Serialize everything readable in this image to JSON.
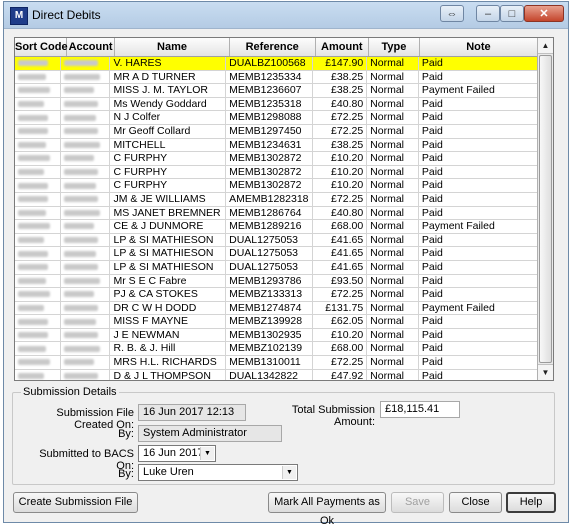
{
  "window": {
    "title": "Direct Debits",
    "app_icon": "lm-app-icon"
  },
  "columns": [
    "Sort Code",
    "Account",
    "Name",
    "Reference",
    "Amount",
    "Type",
    "Note"
  ],
  "rows": [
    {
      "name": "V. HARES",
      "ref": "DUALBZ100568",
      "amount": "£147.90",
      "type": "Normal",
      "note": "Paid",
      "selected": true
    },
    {
      "name": "MR A D TURNER",
      "ref": "MEMB1235334",
      "amount": "£38.25",
      "type": "Normal",
      "note": "Paid"
    },
    {
      "name": "MISS J. M. TAYLOR",
      "ref": "MEMB1236607",
      "amount": "£38.25",
      "type": "Normal",
      "note": "Payment Failed"
    },
    {
      "name": "Ms Wendy Goddard",
      "ref": "MEMB1235318",
      "amount": "£40.80",
      "type": "Normal",
      "note": "Paid"
    },
    {
      "name": "N J Colfer",
      "ref": "MEMB1298088",
      "amount": "£72.25",
      "type": "Normal",
      "note": "Paid"
    },
    {
      "name": "Mr Geoff Collard",
      "ref": "MEMB1297450",
      "amount": "£72.25",
      "type": "Normal",
      "note": "Paid"
    },
    {
      "name": "MITCHELL",
      "ref": "MEMB1234631",
      "amount": "£38.25",
      "type": "Normal",
      "note": "Paid"
    },
    {
      "name": "C FURPHY",
      "ref": "MEMB1302872",
      "amount": "£10.20",
      "type": "Normal",
      "note": "Paid"
    },
    {
      "name": "C FURPHY",
      "ref": "MEMB1302872",
      "amount": "£10.20",
      "type": "Normal",
      "note": "Paid"
    },
    {
      "name": "C FURPHY",
      "ref": "MEMB1302872",
      "amount": "£10.20",
      "type": "Normal",
      "note": "Paid"
    },
    {
      "name": "JM & JE WILLIAMS",
      "ref": "AMEMB1282318",
      "amount": "£72.25",
      "type": "Normal",
      "note": "Paid"
    },
    {
      "name": "MS JANET BREMNER",
      "ref": "MEMB1286764",
      "amount": "£40.80",
      "type": "Normal",
      "note": "Paid"
    },
    {
      "name": "CE & J DUNMORE",
      "ref": "MEMB1289216",
      "amount": "£68.00",
      "type": "Normal",
      "note": "Payment Failed"
    },
    {
      "name": "LP & SI MATHIESON",
      "ref": "DUAL1275053",
      "amount": "£41.65",
      "type": "Normal",
      "note": "Paid"
    },
    {
      "name": "LP & SI MATHIESON",
      "ref": "DUAL1275053",
      "amount": "£41.65",
      "type": "Normal",
      "note": "Paid"
    },
    {
      "name": "LP & SI MATHIESON",
      "ref": "DUAL1275053",
      "amount": "£41.65",
      "type": "Normal",
      "note": "Paid"
    },
    {
      "name": "Mr S E C Fabre",
      "ref": "MEMB1293786",
      "amount": "£93.50",
      "type": "Normal",
      "note": "Paid"
    },
    {
      "name": "PJ & CA STOKES",
      "ref": "MEMBZ133313",
      "amount": "£72.25",
      "type": "Normal",
      "note": "Paid"
    },
    {
      "name": "DR C W H DODD",
      "ref": "MEMB1274874",
      "amount": "£131.75",
      "type": "Normal",
      "note": "Payment Failed"
    },
    {
      "name": "MISS F MAYNE",
      "ref": "MEMBZ139928",
      "amount": "£62.05",
      "type": "Normal",
      "note": "Paid"
    },
    {
      "name": "J E NEWMAN",
      "ref": "MEMB1302935",
      "amount": "£10.20",
      "type": "Normal",
      "note": "Paid"
    },
    {
      "name": "R. B. & J. Hill",
      "ref": "MEMBZ102139",
      "amount": "£68.00",
      "type": "Normal",
      "note": "Paid"
    },
    {
      "name": "MRS H.L. RICHARDS",
      "ref": "MEMB1310011",
      "amount": "£72.25",
      "type": "Normal",
      "note": "Paid"
    },
    {
      "name": "D & J L THOMPSON",
      "ref": "DUAL1342822",
      "amount": "£47.92",
      "type": "Normal",
      "note": "Paid"
    }
  ],
  "submission": {
    "group_label": "Submission Details",
    "created_label": "Submission File Created On:",
    "created_value": "16 Jun 2017 12:13",
    "total_label": "Total Submission Amount:",
    "total_value": "£18,115.41",
    "by_label": "By:",
    "by_value": "System Administrator",
    "bacs_label": "Submitted to BACS On:",
    "bacs_value": "16 Jun  2017",
    "by2_label": "By:",
    "by2_value": "Luke Uren"
  },
  "buttons": {
    "create": "Create Submission File",
    "mark_all": "Mark All Payments as Ok",
    "save": "Save",
    "close": "Close",
    "help": "Help"
  }
}
